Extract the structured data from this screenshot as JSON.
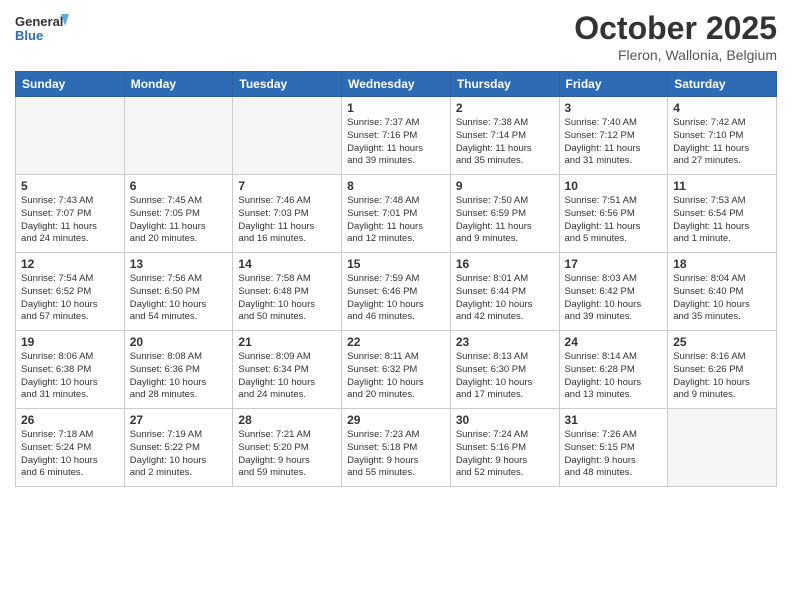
{
  "header": {
    "logo_line1": "General",
    "logo_line2": "Blue",
    "month": "October 2025",
    "location": "Fleron, Wallonia, Belgium"
  },
  "weekdays": [
    "Sunday",
    "Monday",
    "Tuesday",
    "Wednesday",
    "Thursday",
    "Friday",
    "Saturday"
  ],
  "weeks": [
    [
      {
        "day": "",
        "info": ""
      },
      {
        "day": "",
        "info": ""
      },
      {
        "day": "",
        "info": ""
      },
      {
        "day": "1",
        "info": "Sunrise: 7:37 AM\nSunset: 7:16 PM\nDaylight: 11 hours\nand 39 minutes."
      },
      {
        "day": "2",
        "info": "Sunrise: 7:38 AM\nSunset: 7:14 PM\nDaylight: 11 hours\nand 35 minutes."
      },
      {
        "day": "3",
        "info": "Sunrise: 7:40 AM\nSunset: 7:12 PM\nDaylight: 11 hours\nand 31 minutes."
      },
      {
        "day": "4",
        "info": "Sunrise: 7:42 AM\nSunset: 7:10 PM\nDaylight: 11 hours\nand 27 minutes."
      }
    ],
    [
      {
        "day": "5",
        "info": "Sunrise: 7:43 AM\nSunset: 7:07 PM\nDaylight: 11 hours\nand 24 minutes."
      },
      {
        "day": "6",
        "info": "Sunrise: 7:45 AM\nSunset: 7:05 PM\nDaylight: 11 hours\nand 20 minutes."
      },
      {
        "day": "7",
        "info": "Sunrise: 7:46 AM\nSunset: 7:03 PM\nDaylight: 11 hours\nand 16 minutes."
      },
      {
        "day": "8",
        "info": "Sunrise: 7:48 AM\nSunset: 7:01 PM\nDaylight: 11 hours\nand 12 minutes."
      },
      {
        "day": "9",
        "info": "Sunrise: 7:50 AM\nSunset: 6:59 PM\nDaylight: 11 hours\nand 9 minutes."
      },
      {
        "day": "10",
        "info": "Sunrise: 7:51 AM\nSunset: 6:56 PM\nDaylight: 11 hours\nand 5 minutes."
      },
      {
        "day": "11",
        "info": "Sunrise: 7:53 AM\nSunset: 6:54 PM\nDaylight: 11 hours\nand 1 minute."
      }
    ],
    [
      {
        "day": "12",
        "info": "Sunrise: 7:54 AM\nSunset: 6:52 PM\nDaylight: 10 hours\nand 57 minutes."
      },
      {
        "day": "13",
        "info": "Sunrise: 7:56 AM\nSunset: 6:50 PM\nDaylight: 10 hours\nand 54 minutes."
      },
      {
        "day": "14",
        "info": "Sunrise: 7:58 AM\nSunset: 6:48 PM\nDaylight: 10 hours\nand 50 minutes."
      },
      {
        "day": "15",
        "info": "Sunrise: 7:59 AM\nSunset: 6:46 PM\nDaylight: 10 hours\nand 46 minutes."
      },
      {
        "day": "16",
        "info": "Sunrise: 8:01 AM\nSunset: 6:44 PM\nDaylight: 10 hours\nand 42 minutes."
      },
      {
        "day": "17",
        "info": "Sunrise: 8:03 AM\nSunset: 6:42 PM\nDaylight: 10 hours\nand 39 minutes."
      },
      {
        "day": "18",
        "info": "Sunrise: 8:04 AM\nSunset: 6:40 PM\nDaylight: 10 hours\nand 35 minutes."
      }
    ],
    [
      {
        "day": "19",
        "info": "Sunrise: 8:06 AM\nSunset: 6:38 PM\nDaylight: 10 hours\nand 31 minutes."
      },
      {
        "day": "20",
        "info": "Sunrise: 8:08 AM\nSunset: 6:36 PM\nDaylight: 10 hours\nand 28 minutes."
      },
      {
        "day": "21",
        "info": "Sunrise: 8:09 AM\nSunset: 6:34 PM\nDaylight: 10 hours\nand 24 minutes."
      },
      {
        "day": "22",
        "info": "Sunrise: 8:11 AM\nSunset: 6:32 PM\nDaylight: 10 hours\nand 20 minutes."
      },
      {
        "day": "23",
        "info": "Sunrise: 8:13 AM\nSunset: 6:30 PM\nDaylight: 10 hours\nand 17 minutes."
      },
      {
        "day": "24",
        "info": "Sunrise: 8:14 AM\nSunset: 6:28 PM\nDaylight: 10 hours\nand 13 minutes."
      },
      {
        "day": "25",
        "info": "Sunrise: 8:16 AM\nSunset: 6:26 PM\nDaylight: 10 hours\nand 9 minutes."
      }
    ],
    [
      {
        "day": "26",
        "info": "Sunrise: 7:18 AM\nSunset: 5:24 PM\nDaylight: 10 hours\nand 6 minutes."
      },
      {
        "day": "27",
        "info": "Sunrise: 7:19 AM\nSunset: 5:22 PM\nDaylight: 10 hours\nand 2 minutes."
      },
      {
        "day": "28",
        "info": "Sunrise: 7:21 AM\nSunset: 5:20 PM\nDaylight: 9 hours\nand 59 minutes."
      },
      {
        "day": "29",
        "info": "Sunrise: 7:23 AM\nSunset: 5:18 PM\nDaylight: 9 hours\nand 55 minutes."
      },
      {
        "day": "30",
        "info": "Sunrise: 7:24 AM\nSunset: 5:16 PM\nDaylight: 9 hours\nand 52 minutes."
      },
      {
        "day": "31",
        "info": "Sunrise: 7:26 AM\nSunset: 5:15 PM\nDaylight: 9 hours\nand 48 minutes."
      },
      {
        "day": "",
        "info": ""
      }
    ]
  ]
}
